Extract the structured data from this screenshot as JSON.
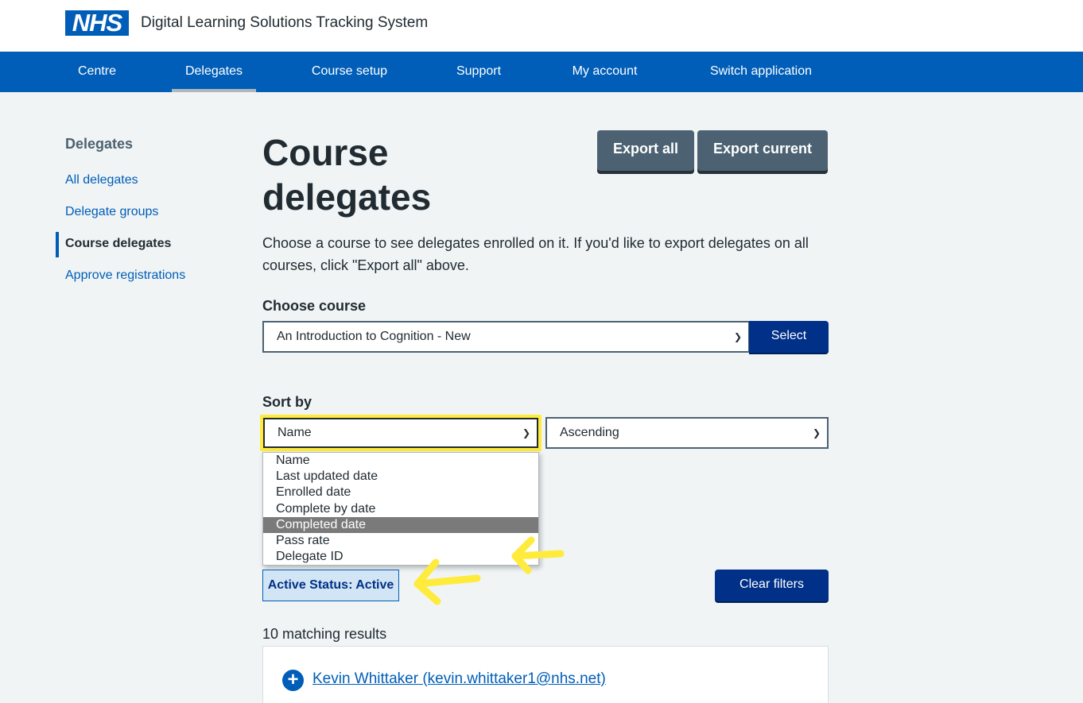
{
  "header": {
    "logo_text": "NHS",
    "service_name": "Digital Learning Solutions Tracking System"
  },
  "nav": {
    "items": [
      {
        "label": "Centre"
      },
      {
        "label": "Delegates"
      },
      {
        "label": "Course setup"
      },
      {
        "label": "Support"
      },
      {
        "label": "My account"
      },
      {
        "label": "Switch application"
      }
    ],
    "active": "Delegates"
  },
  "sidebar": {
    "title": "Delegates",
    "items": [
      {
        "label": "All delegates"
      },
      {
        "label": "Delegate groups"
      },
      {
        "label": "Course delegates"
      },
      {
        "label": "Approve registrations"
      }
    ],
    "current": "Course delegates"
  },
  "main": {
    "title": "Course delegates",
    "export_all_label": "Export all",
    "export_current_label": "Export current",
    "intro": "Choose a course to see delegates enrolled on it. If you'd like to export delegates on all courses, click \"Export all\" above.",
    "choose_course_label": "Choose course",
    "course_selected": "An Introduction to Cognition - New",
    "select_button_label": "Select",
    "sort_by_label": "Sort by",
    "sort_field_selected": "Name",
    "sort_order_selected": "Ascending",
    "sort_options": [
      "Name",
      "Last updated date",
      "Enrolled date",
      "Complete by date",
      "Completed date",
      "Pass rate",
      "Delegate ID"
    ],
    "highlighted_option": "Completed date",
    "filter_tag": "Active Status: Active",
    "clear_filters_label": "Clear filters",
    "results_count": "10 matching results",
    "delegates": [
      {
        "name": "Kevin Whittaker (kevin.whittaker1@nhs.net)"
      }
    ]
  },
  "colors": {
    "nhs_blue": "#005eb8",
    "dark_blue": "#003087",
    "annotation_yellow": "#ffeb3b"
  }
}
